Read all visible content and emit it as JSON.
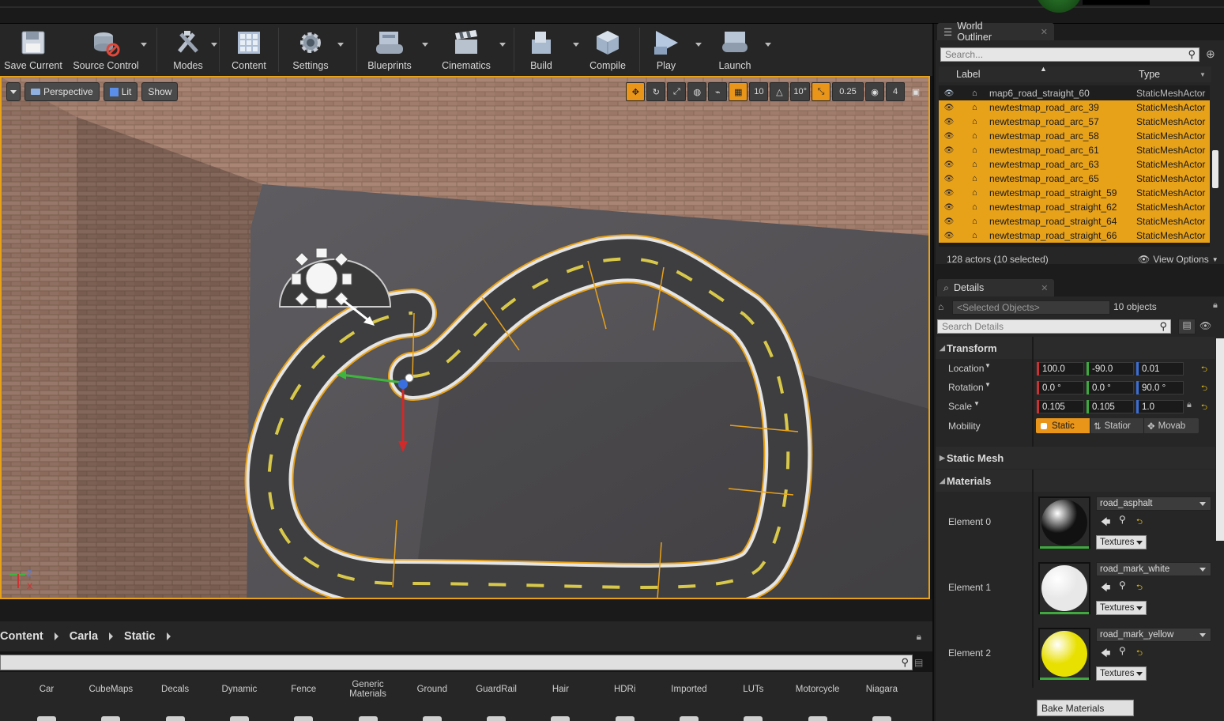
{
  "toolbar": {
    "buttons": [
      {
        "label": "Save Current"
      },
      {
        "label": "Source Control"
      },
      {
        "label": "Modes"
      },
      {
        "label": "Content"
      },
      {
        "label": "Settings"
      },
      {
        "label": "Blueprints"
      },
      {
        "label": "Cinematics"
      },
      {
        "label": "Build"
      },
      {
        "label": "Compile"
      },
      {
        "label": "Play"
      },
      {
        "label": "Launch"
      }
    ]
  },
  "viewport": {
    "perspective_label": "Perspective",
    "lit_label": "Lit",
    "show_label": "Show",
    "grid_snap": "10",
    "rotation_snap": "10°",
    "scale_snap": "0.25",
    "camera_speed": "4",
    "axis_z": "Z",
    "axis_x": "X"
  },
  "outliner": {
    "tab_title": "World Outliner",
    "search_placeholder": "Search...",
    "col_label": "Label",
    "col_type": "Type",
    "rows": [
      {
        "name": "map6_road_straight_60",
        "type": "StaticMeshActor",
        "selected": false
      },
      {
        "name": "newtestmap_road_arc_39",
        "type": "StaticMeshActor",
        "selected": true
      },
      {
        "name": "newtestmap_road_arc_57",
        "type": "StaticMeshActor",
        "selected": true
      },
      {
        "name": "newtestmap_road_arc_58",
        "type": "StaticMeshActor",
        "selected": true
      },
      {
        "name": "newtestmap_road_arc_61",
        "type": "StaticMeshActor",
        "selected": true
      },
      {
        "name": "newtestmap_road_arc_63",
        "type": "StaticMeshActor",
        "selected": true
      },
      {
        "name": "newtestmap_road_arc_65",
        "type": "StaticMeshActor",
        "selected": true
      },
      {
        "name": "newtestmap_road_straight_59",
        "type": "StaticMeshActor",
        "selected": true
      },
      {
        "name": "newtestmap_road_straight_62",
        "type": "StaticMeshActor",
        "selected": true
      },
      {
        "name": "newtestmap_road_straight_64",
        "type": "StaticMeshActor",
        "selected": true
      },
      {
        "name": "newtestmap_road_straight_66",
        "type": "StaticMeshActor",
        "selected": true
      }
    ],
    "status": "128 actors (10 selected)",
    "view_options": "View Options"
  },
  "details": {
    "tab_title": "Details",
    "selected_objects": "<Selected Objects>",
    "object_count": "10 objects",
    "search_placeholder": "Search Details",
    "transform_title": "Transform",
    "location_label": "Location",
    "rotation_label": "Rotation",
    "scale_label": "Scale",
    "mobility_label": "Mobility",
    "location": [
      "100.0",
      "-90.0",
      "0.01"
    ],
    "rotation": [
      "0.0 °",
      "0.0 °",
      "90.0 °"
    ],
    "scale": [
      "0.105",
      "0.105",
      "1.0"
    ],
    "mobility_options": [
      "Static",
      "Statior",
      "Movab"
    ],
    "static_mesh_title": "Static Mesh",
    "materials_title": "Materials",
    "elements": [
      {
        "label": "Element 0",
        "material": "road_asphalt",
        "textures": "Textures",
        "color": "#111111"
      },
      {
        "label": "Element 1",
        "material": "road_mark_white",
        "textures": "Textures",
        "color": "#e8e8e8"
      },
      {
        "label": "Element 2",
        "material": "road_mark_yellow",
        "textures": "Textures",
        "color": "#e8e000"
      }
    ],
    "bake_materials": "Bake Materials"
  },
  "content_browser": {
    "breadcrumb": [
      "Content",
      "Carla",
      "Static"
    ],
    "folders": [
      "Car",
      "CubeMaps",
      "Decals",
      "Dynamic",
      "Fence",
      "Generic\nMaterials",
      "Ground",
      "GuardRail",
      "Hair",
      "HDRi",
      "Imported",
      "LUTs",
      "Motorcycle",
      "Niagara"
    ]
  },
  "colors": {
    "selection": "#e8a21a",
    "accent_orange": "#e8951a",
    "road_yellow": "#d8c84a"
  }
}
